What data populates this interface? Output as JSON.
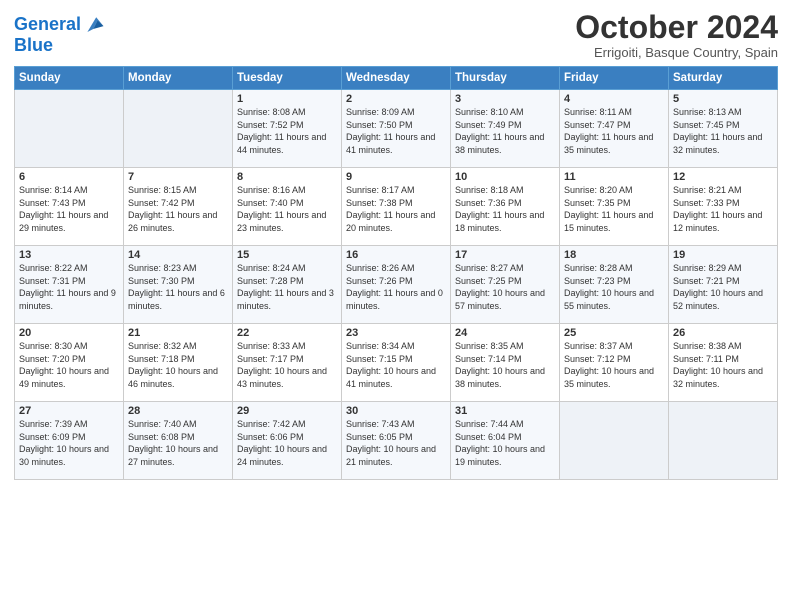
{
  "header": {
    "logo_line1": "General",
    "logo_line2": "Blue",
    "month": "October 2024",
    "location": "Errigoiti, Basque Country, Spain"
  },
  "weekdays": [
    "Sunday",
    "Monday",
    "Tuesday",
    "Wednesday",
    "Thursday",
    "Friday",
    "Saturday"
  ],
  "weeks": [
    [
      {
        "day": "",
        "info": ""
      },
      {
        "day": "",
        "info": ""
      },
      {
        "day": "1",
        "info": "Sunrise: 8:08 AM\nSunset: 7:52 PM\nDaylight: 11 hours and 44 minutes."
      },
      {
        "day": "2",
        "info": "Sunrise: 8:09 AM\nSunset: 7:50 PM\nDaylight: 11 hours and 41 minutes."
      },
      {
        "day": "3",
        "info": "Sunrise: 8:10 AM\nSunset: 7:49 PM\nDaylight: 11 hours and 38 minutes."
      },
      {
        "day": "4",
        "info": "Sunrise: 8:11 AM\nSunset: 7:47 PM\nDaylight: 11 hours and 35 minutes."
      },
      {
        "day": "5",
        "info": "Sunrise: 8:13 AM\nSunset: 7:45 PM\nDaylight: 11 hours and 32 minutes."
      }
    ],
    [
      {
        "day": "6",
        "info": "Sunrise: 8:14 AM\nSunset: 7:43 PM\nDaylight: 11 hours and 29 minutes."
      },
      {
        "day": "7",
        "info": "Sunrise: 8:15 AM\nSunset: 7:42 PM\nDaylight: 11 hours and 26 minutes."
      },
      {
        "day": "8",
        "info": "Sunrise: 8:16 AM\nSunset: 7:40 PM\nDaylight: 11 hours and 23 minutes."
      },
      {
        "day": "9",
        "info": "Sunrise: 8:17 AM\nSunset: 7:38 PM\nDaylight: 11 hours and 20 minutes."
      },
      {
        "day": "10",
        "info": "Sunrise: 8:18 AM\nSunset: 7:36 PM\nDaylight: 11 hours and 18 minutes."
      },
      {
        "day": "11",
        "info": "Sunrise: 8:20 AM\nSunset: 7:35 PM\nDaylight: 11 hours and 15 minutes."
      },
      {
        "day": "12",
        "info": "Sunrise: 8:21 AM\nSunset: 7:33 PM\nDaylight: 11 hours and 12 minutes."
      }
    ],
    [
      {
        "day": "13",
        "info": "Sunrise: 8:22 AM\nSunset: 7:31 PM\nDaylight: 11 hours and 9 minutes."
      },
      {
        "day": "14",
        "info": "Sunrise: 8:23 AM\nSunset: 7:30 PM\nDaylight: 11 hours and 6 minutes."
      },
      {
        "day": "15",
        "info": "Sunrise: 8:24 AM\nSunset: 7:28 PM\nDaylight: 11 hours and 3 minutes."
      },
      {
        "day": "16",
        "info": "Sunrise: 8:26 AM\nSunset: 7:26 PM\nDaylight: 11 hours and 0 minutes."
      },
      {
        "day": "17",
        "info": "Sunrise: 8:27 AM\nSunset: 7:25 PM\nDaylight: 10 hours and 57 minutes."
      },
      {
        "day": "18",
        "info": "Sunrise: 8:28 AM\nSunset: 7:23 PM\nDaylight: 10 hours and 55 minutes."
      },
      {
        "day": "19",
        "info": "Sunrise: 8:29 AM\nSunset: 7:21 PM\nDaylight: 10 hours and 52 minutes."
      }
    ],
    [
      {
        "day": "20",
        "info": "Sunrise: 8:30 AM\nSunset: 7:20 PM\nDaylight: 10 hours and 49 minutes."
      },
      {
        "day": "21",
        "info": "Sunrise: 8:32 AM\nSunset: 7:18 PM\nDaylight: 10 hours and 46 minutes."
      },
      {
        "day": "22",
        "info": "Sunrise: 8:33 AM\nSunset: 7:17 PM\nDaylight: 10 hours and 43 minutes."
      },
      {
        "day": "23",
        "info": "Sunrise: 8:34 AM\nSunset: 7:15 PM\nDaylight: 10 hours and 41 minutes."
      },
      {
        "day": "24",
        "info": "Sunrise: 8:35 AM\nSunset: 7:14 PM\nDaylight: 10 hours and 38 minutes."
      },
      {
        "day": "25",
        "info": "Sunrise: 8:37 AM\nSunset: 7:12 PM\nDaylight: 10 hours and 35 minutes."
      },
      {
        "day": "26",
        "info": "Sunrise: 8:38 AM\nSunset: 7:11 PM\nDaylight: 10 hours and 32 minutes."
      }
    ],
    [
      {
        "day": "27",
        "info": "Sunrise: 7:39 AM\nSunset: 6:09 PM\nDaylight: 10 hours and 30 minutes."
      },
      {
        "day": "28",
        "info": "Sunrise: 7:40 AM\nSunset: 6:08 PM\nDaylight: 10 hours and 27 minutes."
      },
      {
        "day": "29",
        "info": "Sunrise: 7:42 AM\nSunset: 6:06 PM\nDaylight: 10 hours and 24 minutes."
      },
      {
        "day": "30",
        "info": "Sunrise: 7:43 AM\nSunset: 6:05 PM\nDaylight: 10 hours and 21 minutes."
      },
      {
        "day": "31",
        "info": "Sunrise: 7:44 AM\nSunset: 6:04 PM\nDaylight: 10 hours and 19 minutes."
      },
      {
        "day": "",
        "info": ""
      },
      {
        "day": "",
        "info": ""
      }
    ]
  ]
}
